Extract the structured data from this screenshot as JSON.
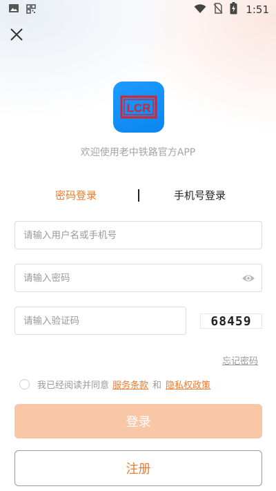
{
  "status_bar": {
    "time": "1:51",
    "icons": [
      "image-icon",
      "grid-icon",
      "wifi-icon",
      "no-sim-icon",
      "battery-charging-icon"
    ]
  },
  "header": {
    "close_icon": "close-icon"
  },
  "logo": {
    "text": "LCR",
    "bg_color": "#0a86f0",
    "mark_color": "#d9232d"
  },
  "welcome_text": "欢迎使用老中铁路官方APP",
  "tabs": {
    "password_login": "密码登录",
    "phone_login": "手机号登录",
    "active_color": "#f07a2a"
  },
  "form": {
    "username_placeholder": "请输入用户名或手机号",
    "password_placeholder": "请输入密码",
    "captcha_placeholder": "请输入验证码",
    "captcha_value": "68459"
  },
  "forgot_password": "忘记密码",
  "agreement": {
    "prefix": "我已经阅读并同意",
    "terms": "服务条款",
    "and": "和",
    "privacy": "隐私权政策"
  },
  "buttons": {
    "login": "登录",
    "register": "注册"
  },
  "colors": {
    "accent": "#f07a2a",
    "login_disabled": "#f9c7a6"
  }
}
